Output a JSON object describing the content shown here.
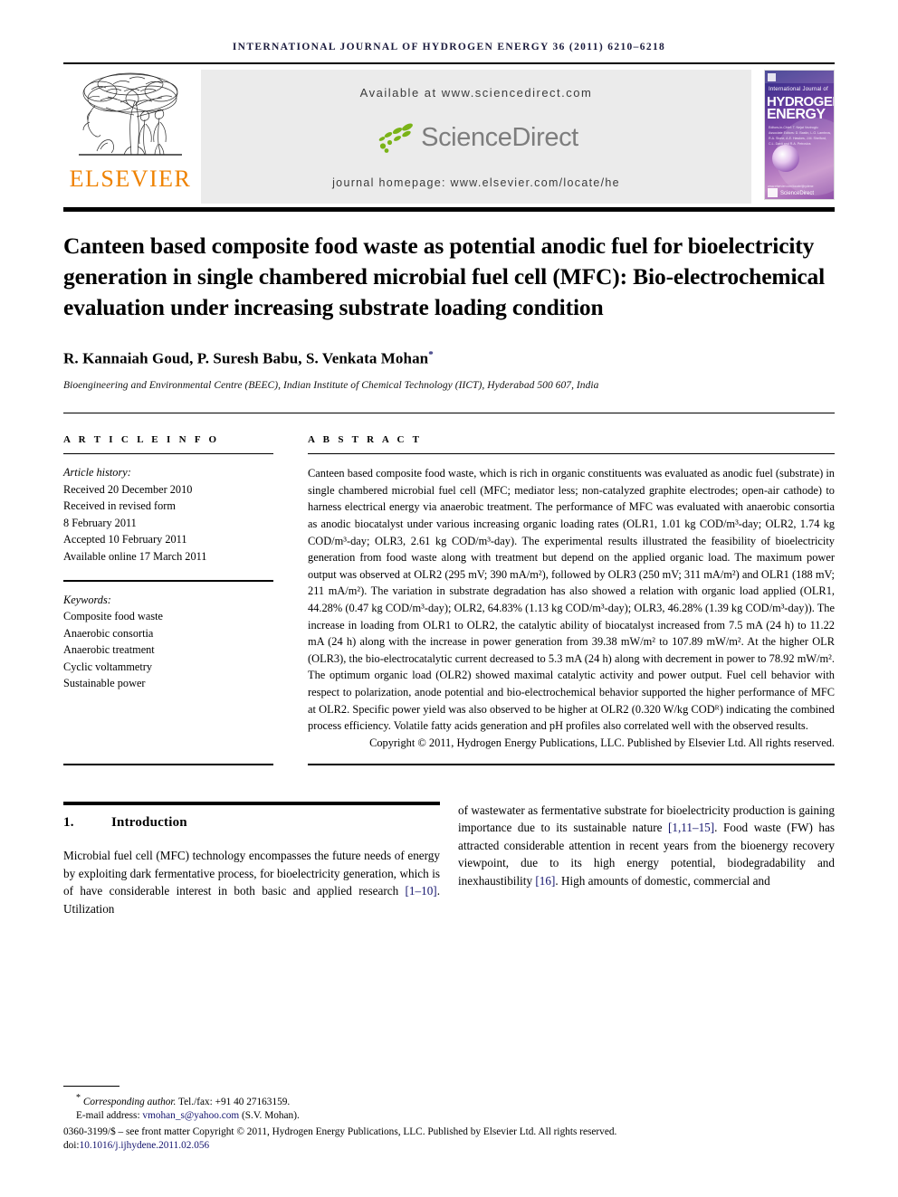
{
  "running_head": "INTERNATIONAL JOURNAL OF HYDROGEN ENERGY 36 (2011) 6210–6218",
  "banner": {
    "elsevier_wordmark": "ELSEVIER",
    "available_at": "Available at www.sciencedirect.com",
    "sciencedirect_word": "ScienceDirect",
    "journal_homepage": "journal homepage: www.elsevier.com/locate/he",
    "cover": {
      "small_title": "International Journal of",
      "big_line1": "HYDROGEN",
      "big_line2": "ENERGY",
      "editors": "Editors-in-Chief: T. Nejat Veziroglu\nAssociate Editors: D. Bastin, L.G. Lambros, R.A. Stone, A.E. Hawkes, J.M. Shelford, C.L. Davit and R.A. Petrovics",
      "bottom_note": "www.elsevier.com/locate/ijhydene",
      "sciencedirect": "ScienceDirect"
    }
  },
  "title": "Canteen based composite food waste as potential anodic fuel for bioelectricity generation in single chambered microbial fuel cell (MFC): Bio-electrochemical evaluation under increasing substrate loading condition",
  "authors": "R. Kannaiah Goud, P. Suresh Babu, S. Venkata Mohan",
  "author_marker": "*",
  "affiliation": "Bioengineering and Environmental Centre (BEEC), Indian Institute of Chemical Technology (IICT), Hyderabad 500 607, India",
  "article_info": {
    "heading": "A R T I C L E   I N F O",
    "history_label": "Article history:",
    "history": [
      "Received 20 December 2010",
      "Received in revised form",
      "8 February 2011",
      "Accepted 10 February 2011",
      "Available online 17 March 2011"
    ],
    "keywords_label": "Keywords:",
    "keywords": [
      "Composite food waste",
      "Anaerobic consortia",
      "Anaerobic treatment",
      "Cyclic voltammetry",
      "Sustainable power"
    ]
  },
  "abstract": {
    "heading": "A B S T R A C T",
    "body": "Canteen based composite food waste, which is rich in organic constituents was evaluated as anodic fuel (substrate) in single chambered microbial fuel cell (MFC; mediator less; non-catalyzed graphite electrodes; open-air cathode) to harness electrical energy via anaerobic treatment. The performance of MFC was evaluated with anaerobic consortia as anodic biocatalyst under various increasing organic loading rates (OLR1, 1.01 kg COD/m³-day; OLR2, 1.74 kg COD/m³-day; OLR3, 2.61 kg COD/m³-day). The experimental results illustrated the feasibility of bioelectricity generation from food waste along with treatment but depend on the applied organic load. The maximum power output was observed at OLR2 (295 mV; 390 mA/m²), followed by OLR3 (250 mV; 311 mA/m²) and OLR1 (188 mV; 211 mA/m²). The variation in substrate degradation has also showed a relation with organic load applied (OLR1, 44.28% (0.47 kg COD/m³-day); OLR2, 64.83% (1.13 kg COD/m³-day); OLR3, 46.28% (1.39 kg COD/m³-day)). The increase in loading from OLR1 to OLR2, the catalytic ability of biocatalyst increased from 7.5 mA (24 h) to 11.22 mA (24 h) along with the increase in power generation from 39.38 mW/m² to 107.89 mW/m². At the higher OLR (OLR3), the bio-electrocatalytic current decreased to 5.3 mA (24 h) along with decrement in power to 78.92 mW/m². The optimum organic load (OLR2) showed maximal catalytic activity and power output. Fuel cell behavior with respect to polarization, anode potential and bio-electrochemical behavior supported the higher performance of MFC at OLR2. Specific power yield was also observed to be higher at OLR2 (0.320 W/kg CODᴿ) indicating the combined process efficiency. Volatile fatty acids generation and pH profiles also correlated well with the observed results.",
    "copyright": "Copyright © 2011, Hydrogen Energy Publications, LLC. Published by Elsevier Ltd. All rights reserved."
  },
  "introduction": {
    "number": "1.",
    "heading": "Introduction",
    "left_part1": "Microbial fuel cell (MFC) technology encompasses the future needs of energy by exploiting dark fermentative process, for bioelectricity generation, which is of have considerable interest in both basic and applied research ",
    "left_ref1": "[1–10]",
    "left_part2": ". Utilization",
    "right_part1": "of wastewater as fermentative substrate for bioelectricity production is gaining importance due to its sustainable nature ",
    "right_ref1": "[1,11–15]",
    "right_part2": ". Food waste (FW) has attracted considerable attention in recent years from the bioenergy recovery viewpoint, due to its high energy potential, biodegradability and inexhaustibility ",
    "right_ref2": "[16]",
    "right_part3": ". High amounts of domestic, commercial and"
  },
  "footnote": {
    "marker": "*",
    "corresponding": "Corresponding author.",
    "tel": " Tel./fax: +91 40 27163159.",
    "email_label": "E-mail address: ",
    "email": "vmohan_s@yahoo.com",
    "email_suffix": " (S.V. Mohan).",
    "issn": "0360-3199/$ – see front matter Copyright © 2011, Hydrogen Energy Publications, LLC. Published by Elsevier Ltd. All rights reserved.",
    "doi_label": "doi:",
    "doi": "10.1016/j.ijhydene.2011.02.056"
  },
  "colors": {
    "elsevier_orange": "#ef8200",
    "link_navy": "#14146e",
    "banner_gray": "#ebebeb",
    "sciencedirect_gray": "#7d7d7d",
    "sciencedirect_green": "#7ab317"
  }
}
